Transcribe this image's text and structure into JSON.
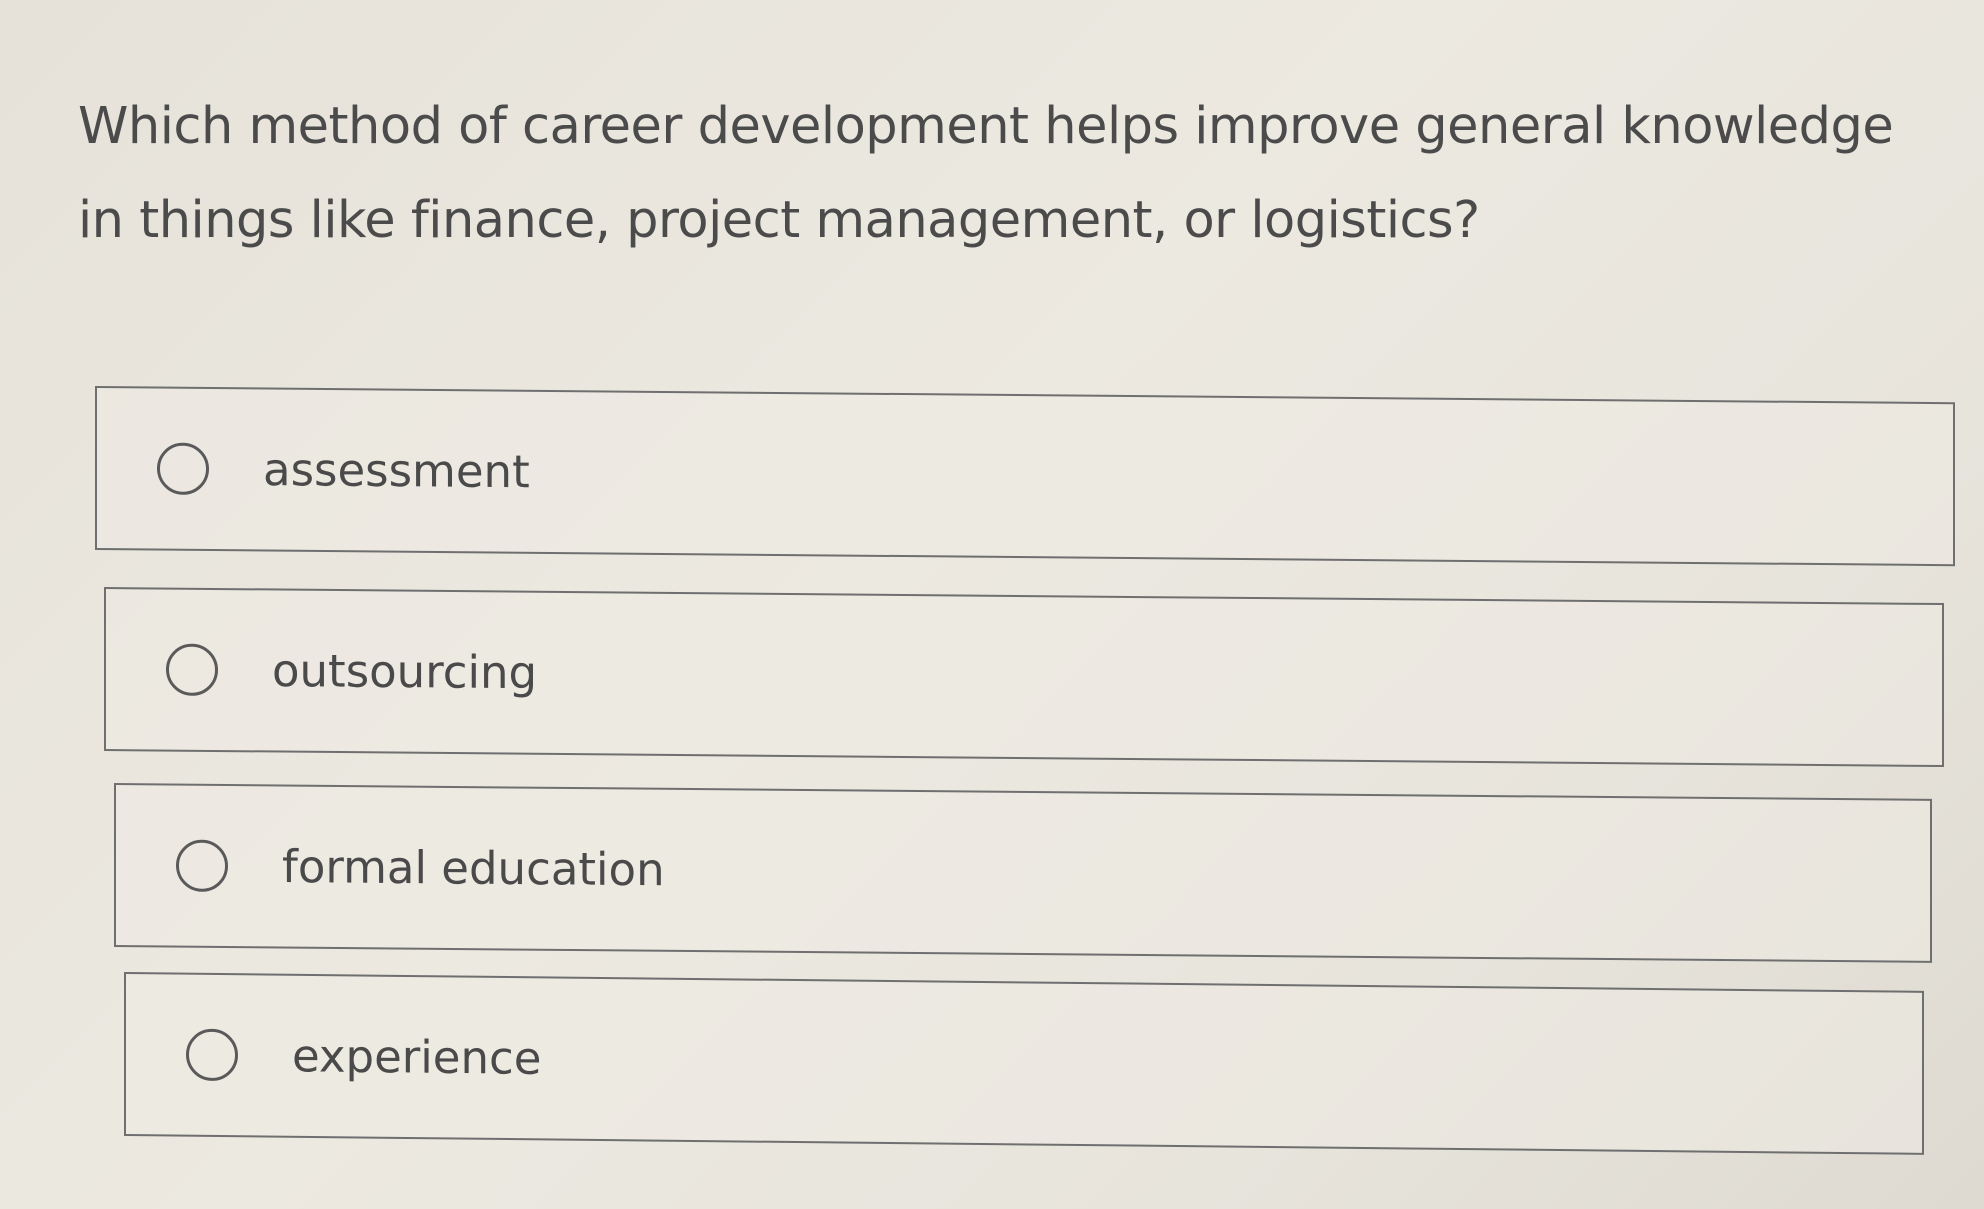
{
  "question": {
    "text": "Which method of career development helps improve general knowledge in things like finance, project management, or logistics?"
  },
  "options": [
    {
      "label": "assessment",
      "selected": false
    },
    {
      "label": "outsourcing",
      "selected": false
    },
    {
      "label": "formal education",
      "selected": false
    },
    {
      "label": "experience",
      "selected": false
    }
  ]
}
